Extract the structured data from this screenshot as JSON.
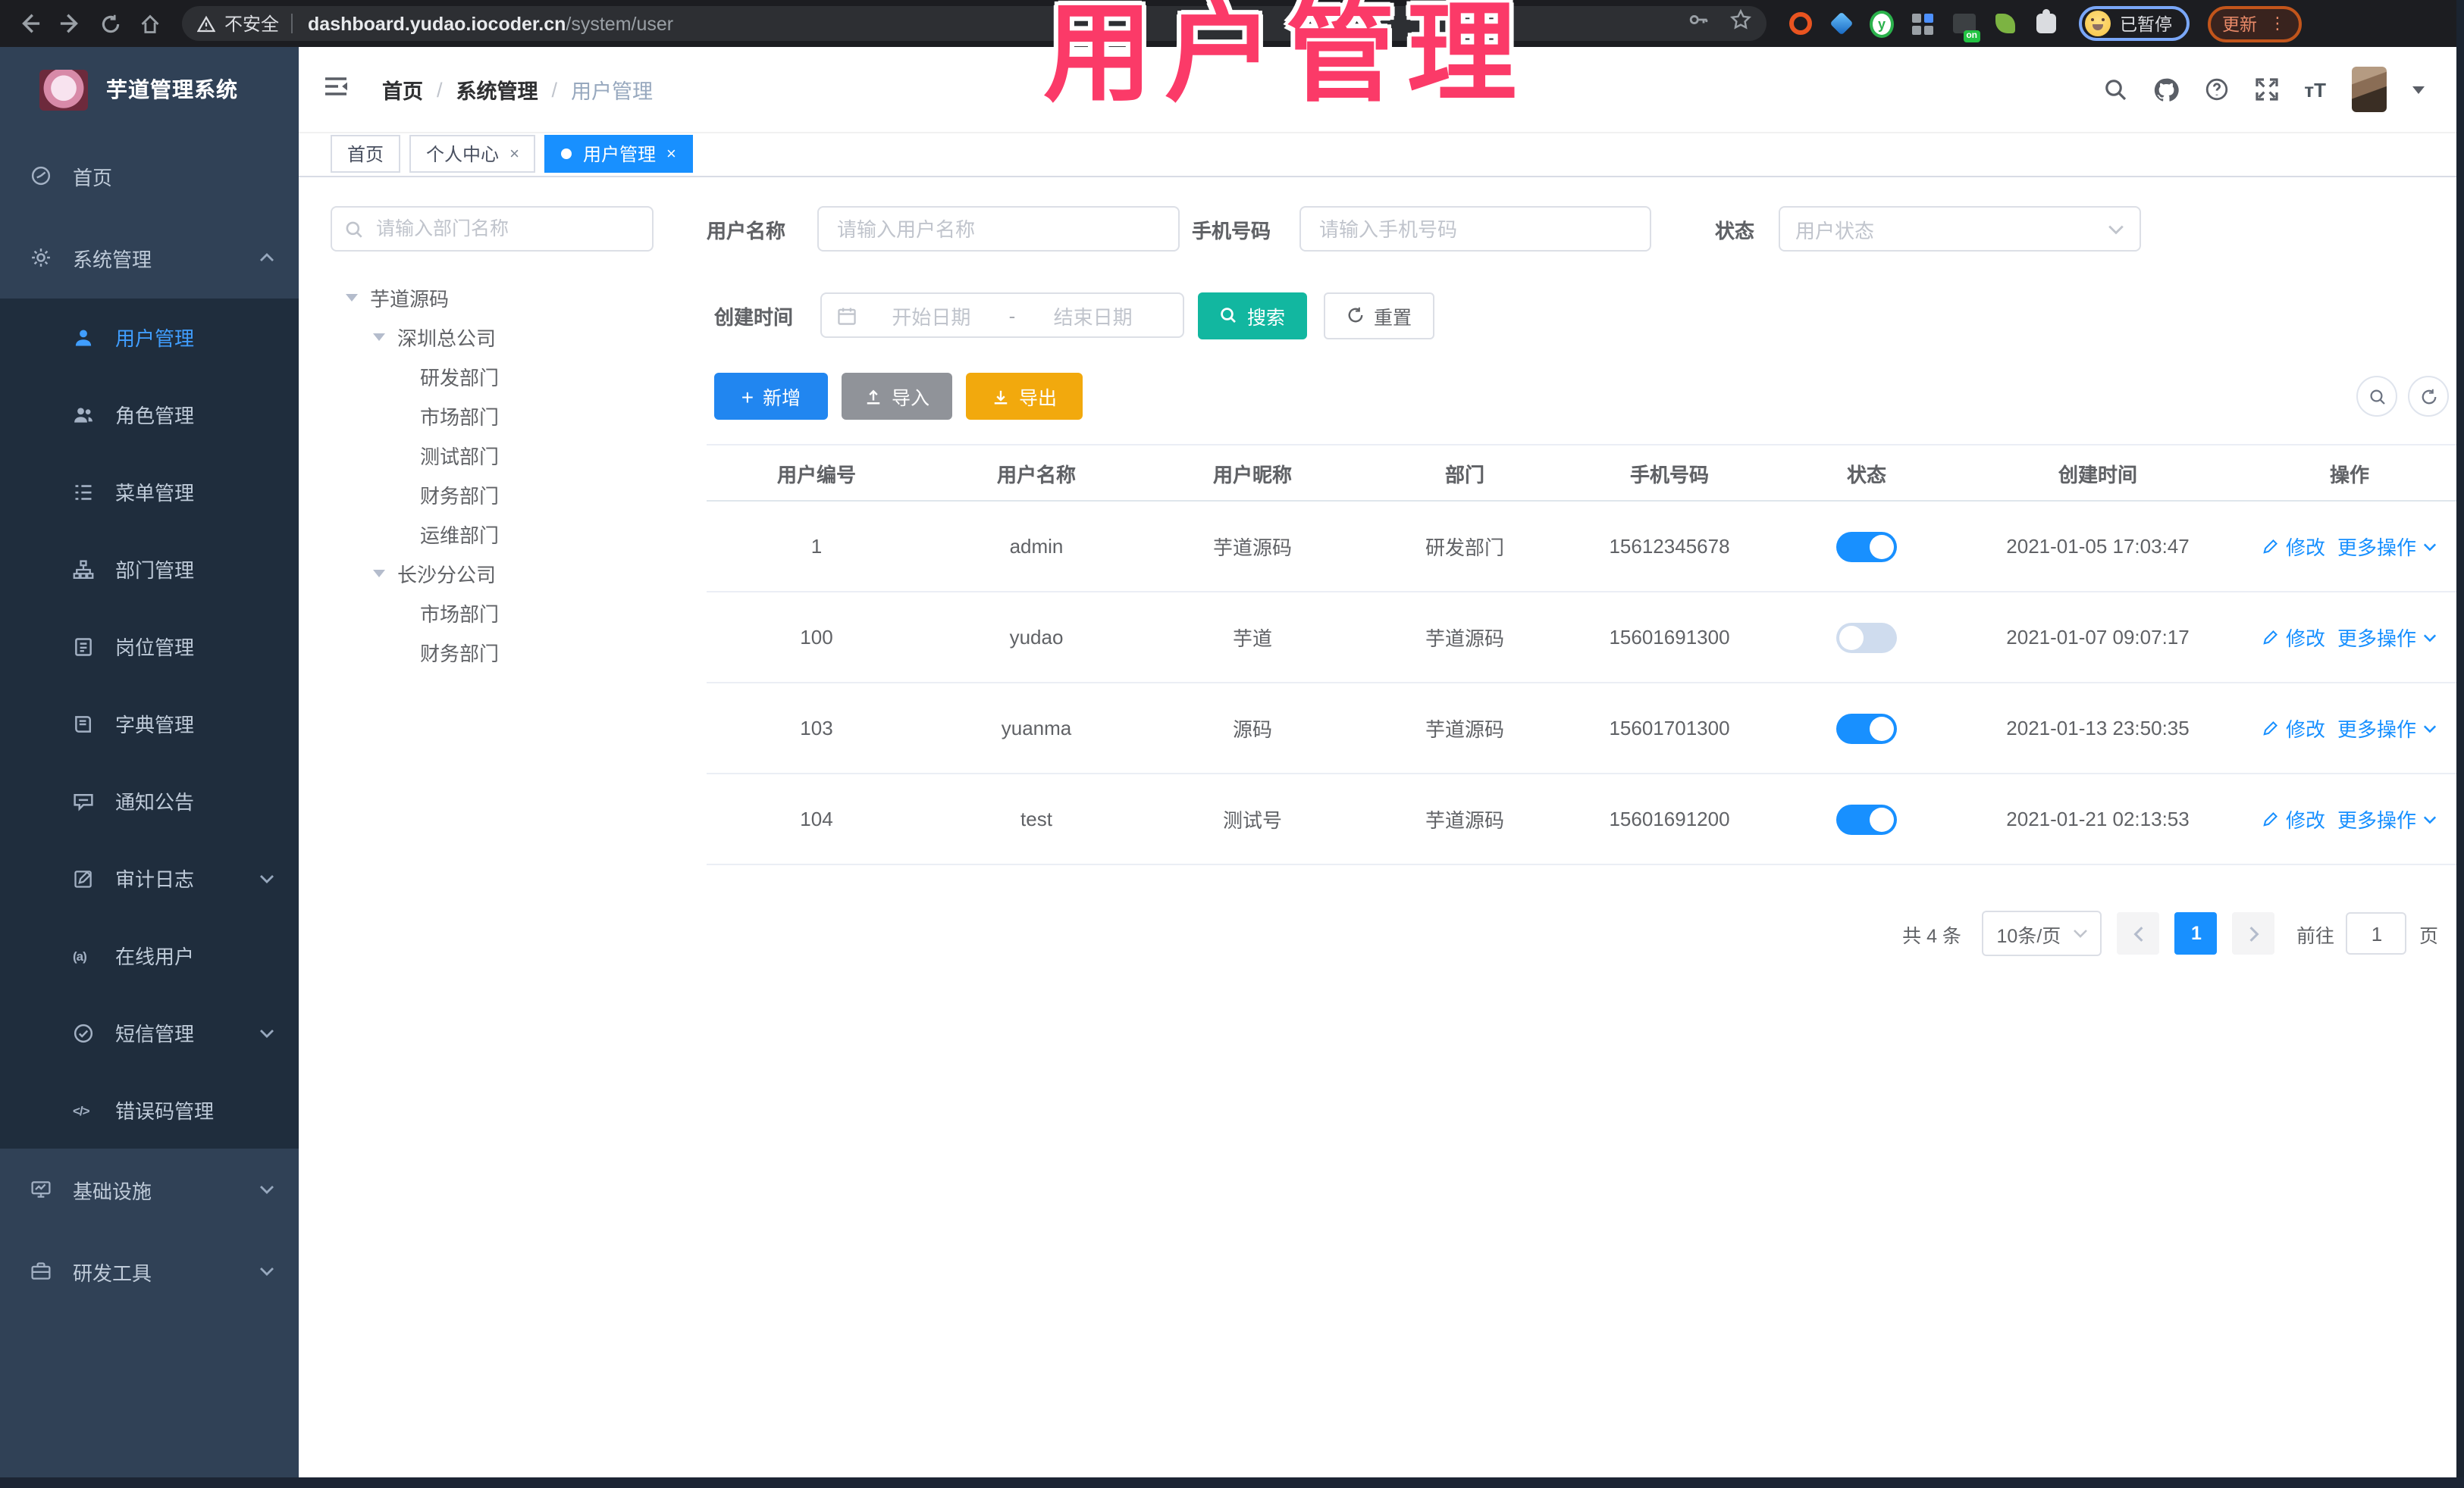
{
  "browser": {
    "security_label": "不安全",
    "url_host": "dashboard.yudao.iocoder.cn",
    "url_path": "/system/user",
    "ext_badge": "on",
    "profile_status": "已暂停",
    "update_label": "更新"
  },
  "overlay": {
    "title": "用户管理"
  },
  "sidebar": {
    "app_title": "芋道管理系统",
    "items": [
      {
        "label": "首页"
      },
      {
        "label": "系统管理"
      },
      {
        "label": "用户管理"
      },
      {
        "label": "角色管理"
      },
      {
        "label": "菜单管理"
      },
      {
        "label": "部门管理"
      },
      {
        "label": "岗位管理"
      },
      {
        "label": "字典管理"
      },
      {
        "label": "通知公告"
      },
      {
        "label": "审计日志"
      },
      {
        "label": "在线用户"
      },
      {
        "label": "短信管理"
      },
      {
        "label": "错误码管理"
      },
      {
        "label": "基础设施"
      },
      {
        "label": "研发工具"
      }
    ]
  },
  "header": {
    "breadcrumb": [
      "首页",
      "系统管理",
      "用户管理"
    ]
  },
  "tabs": {
    "items": [
      {
        "label": "首页"
      },
      {
        "label": "个人中心",
        "close": "×"
      },
      {
        "label": "用户管理",
        "close": "×"
      }
    ]
  },
  "dept": {
    "search_placeholder": "请输入部门名称",
    "nodes": [
      {
        "label": "芋道源码"
      },
      {
        "label": "深圳总公司"
      },
      {
        "label": "研发部门"
      },
      {
        "label": "市场部门"
      },
      {
        "label": "测试部门"
      },
      {
        "label": "财务部门"
      },
      {
        "label": "运维部门"
      },
      {
        "label": "长沙分公司"
      },
      {
        "label": "市场部门"
      },
      {
        "label": "财务部门"
      }
    ]
  },
  "filters": {
    "username_label": "用户名称",
    "username_placeholder": "请输入用户名称",
    "mobile_label": "手机号码",
    "mobile_placeholder": "请输入手机号码",
    "status_label": "状态",
    "status_placeholder": "用户状态",
    "created_label": "创建时间",
    "date_start_placeholder": "开始日期",
    "date_separator": "-",
    "date_end_placeholder": "结束日期",
    "search_label": "搜索",
    "reset_label": "重置"
  },
  "toolbar": {
    "add_label": "新增",
    "import_label": "导入",
    "export_label": "导出"
  },
  "table": {
    "columns": [
      "用户编号",
      "用户名称",
      "用户昵称",
      "部门",
      "手机号码",
      "状态",
      "创建时间",
      "操作"
    ],
    "actions": {
      "edit": "修改",
      "more": "更多操作"
    },
    "rows": [
      {
        "id": "1",
        "username": "admin",
        "nickname": "芋道源码",
        "dept": "研发部门",
        "mobile": "15612345678",
        "status": "on",
        "created": "2021-01-05 17:03:47"
      },
      {
        "id": "100",
        "username": "yudao",
        "nickname": "芋道",
        "dept": "芋道源码",
        "mobile": "15601691300",
        "status": "off",
        "created": "2021-01-07 09:07:17"
      },
      {
        "id": "103",
        "username": "yuanma",
        "nickname": "源码",
        "dept": "芋道源码",
        "mobile": "15601701300",
        "status": "on",
        "created": "2021-01-13 23:50:35"
      },
      {
        "id": "104",
        "username": "test",
        "nickname": "测试号",
        "dept": "芋道源码",
        "mobile": "15601691200",
        "status": "on",
        "created": "2021-01-21 02:13:53"
      }
    ]
  },
  "pagination": {
    "total": "共 4 条",
    "size": "10条/页",
    "page": "1",
    "goto_label": "前往",
    "goto_value": "1",
    "unit": "页"
  },
  "colors": {
    "primary": "#1890ff",
    "menu_active": "#409eff",
    "sidebar_bg": "#304156",
    "submenu_bg": "#1f2d3d",
    "search_button": "#12b7a0",
    "export_button": "#f2a90d",
    "import_button": "#909399",
    "overlay_pink": "#fb3a68"
  }
}
